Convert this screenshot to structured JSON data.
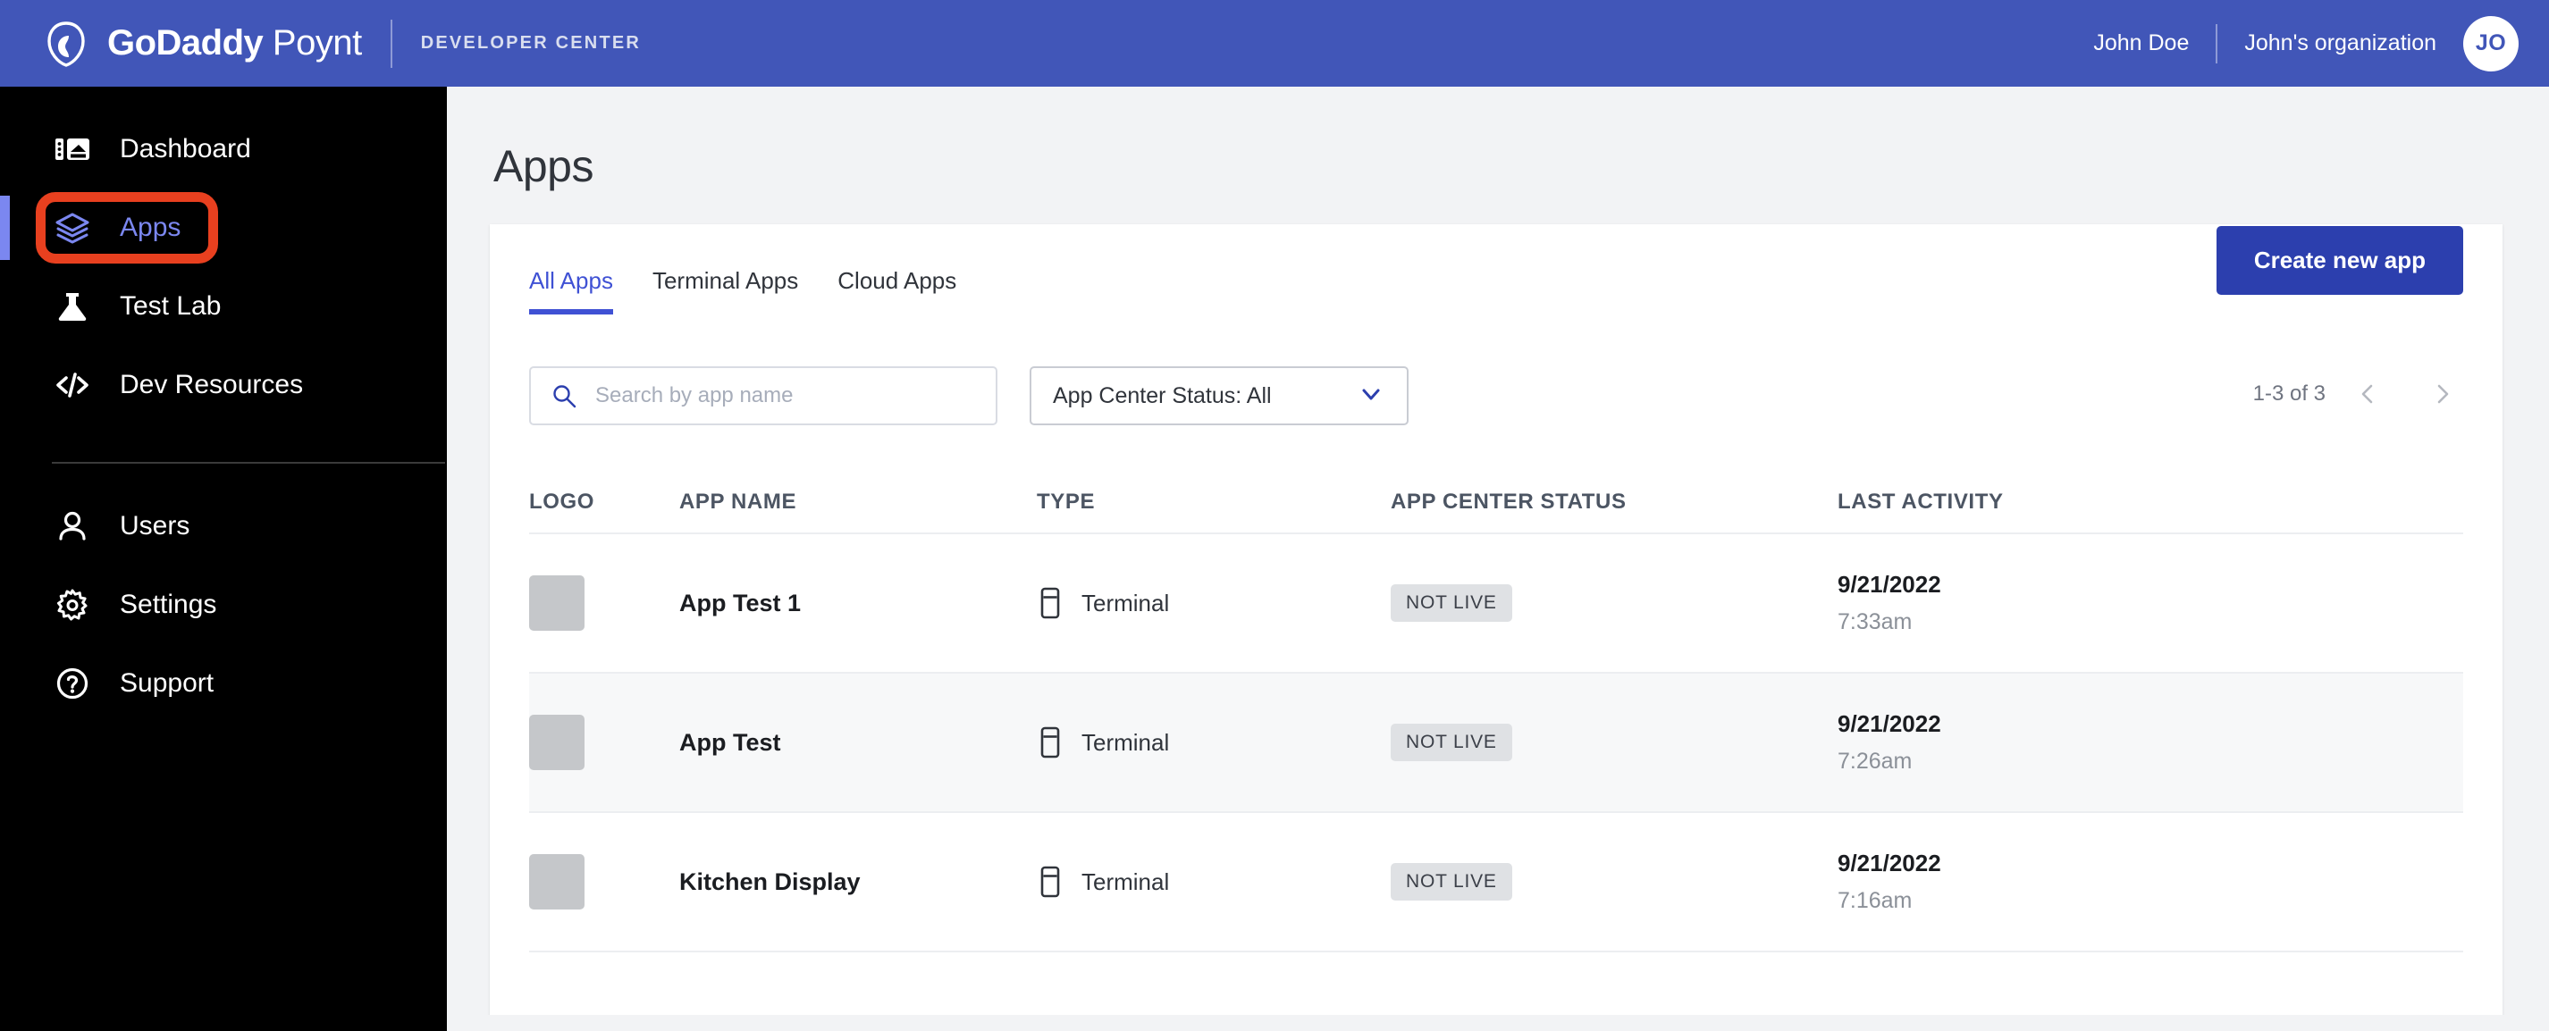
{
  "header": {
    "brand_bold": "GoDaddy",
    "brand_light": " Poynt",
    "brand_sub": "DEVELOPER CENTER",
    "user_name": "John Doe",
    "organization": "John's organization",
    "avatar_initials": "JO",
    "brand_bg": "#4156b8"
  },
  "sidebar": {
    "primary_items": [
      {
        "label": "Dashboard",
        "icon": "dashboard-icon",
        "active": false
      },
      {
        "label": "Apps",
        "icon": "layers-icon",
        "active": true
      },
      {
        "label": "Test Lab",
        "icon": "flask-icon",
        "active": false
      },
      {
        "label": "Dev Resources",
        "icon": "code-icon",
        "active": false
      }
    ],
    "secondary_items": [
      {
        "label": "Users",
        "icon": "user-icon",
        "active": false
      },
      {
        "label": "Settings",
        "icon": "gear-icon",
        "active": false
      },
      {
        "label": "Support",
        "icon": "help-circle-icon",
        "active": false
      }
    ],
    "active_color": "#7b87f0",
    "highlight_color": "#e8401f"
  },
  "main": {
    "page_title": "Apps",
    "tabs": [
      {
        "label": "All Apps",
        "active": true
      },
      {
        "label": "Terminal Apps",
        "active": false
      },
      {
        "label": "Cloud Apps",
        "active": false
      }
    ],
    "create_button": "Create new app",
    "search": {
      "placeholder": "Search by app name",
      "value": ""
    },
    "status_filter": {
      "selected": "App Center Status: All"
    },
    "pagination": {
      "count": "1-3 of 3",
      "prev_icon": "chevron-left-icon",
      "next_icon": "chevron-right-icon"
    },
    "table": {
      "columns": [
        "LOGO",
        "APP NAME",
        "TYPE",
        "APP CENTER STATUS",
        "LAST ACTIVITY"
      ],
      "rows": [
        {
          "logo": "",
          "name": "App Test 1",
          "type": "Terminal",
          "type_icon": "terminal-device-icon",
          "status": "NOT LIVE",
          "date": "9/21/2022",
          "time": "7:33am"
        },
        {
          "logo": "",
          "name": "App Test",
          "type": "Terminal",
          "type_icon": "terminal-device-icon",
          "status": "NOT LIVE",
          "date": "9/21/2022",
          "time": "7:26am"
        },
        {
          "logo": "",
          "name": "Kitchen Display",
          "type": "Terminal",
          "type_icon": "terminal-device-icon",
          "status": "NOT LIVE",
          "date": "9/21/2022",
          "time": "7:16am"
        }
      ]
    }
  }
}
